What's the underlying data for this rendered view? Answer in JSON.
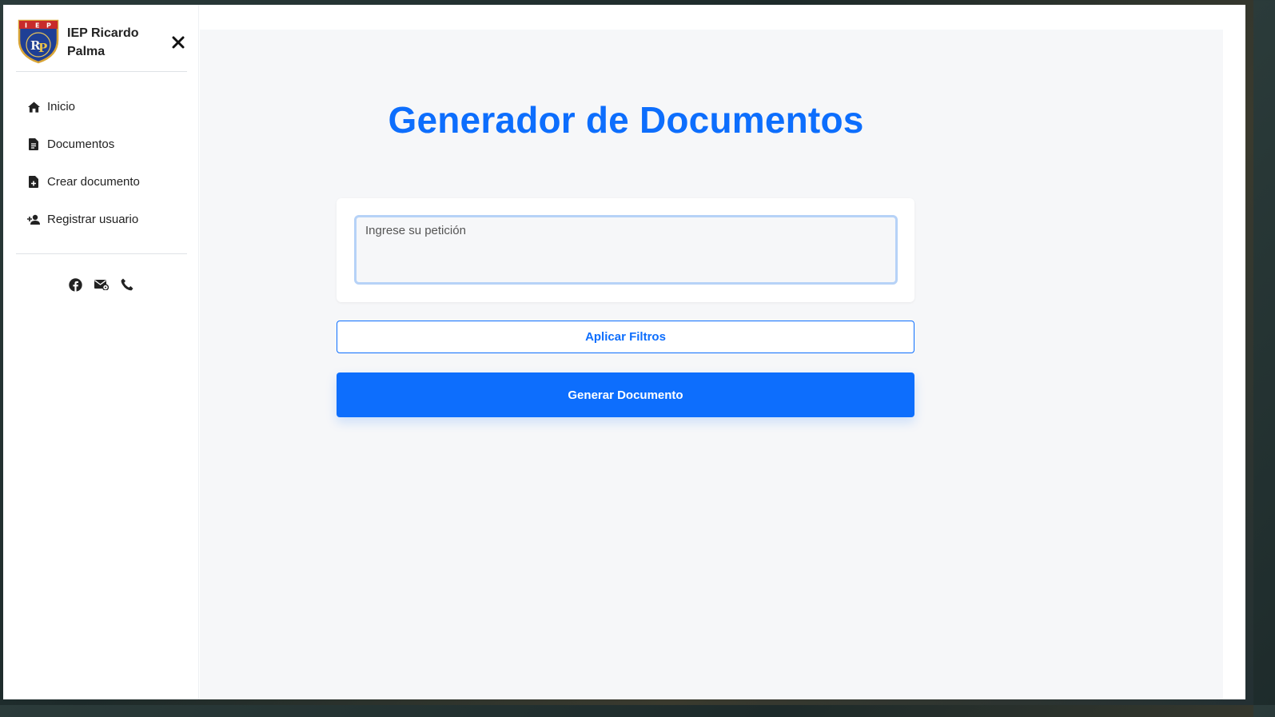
{
  "sidebar": {
    "brand": {
      "name": "IEP Ricardo Palma",
      "logo_text": "I E P",
      "logo_monogram": "RP"
    },
    "nav": [
      {
        "label": "Inicio",
        "icon": "home-icon"
      },
      {
        "label": "Documentos",
        "icon": "document-icon"
      },
      {
        "label": "Crear documento",
        "icon": "add-document-icon"
      },
      {
        "label": "Registrar usuario",
        "icon": "add-user-icon"
      }
    ],
    "socials": [
      "facebook-icon",
      "mail-icon",
      "phone-icon"
    ]
  },
  "main": {
    "title": "Generador de Documentos",
    "request": {
      "placeholder": "Ingrese su petición",
      "value": ""
    },
    "apply_filters_label": "Aplicar Filtros",
    "generate_label": "Generar Documento"
  },
  "colors": {
    "accent": "#0d6efd",
    "input_border": "#b6d2f7",
    "main_bg": "#f6f7f9"
  }
}
